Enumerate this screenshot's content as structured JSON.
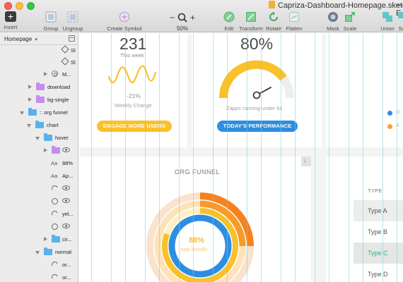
{
  "window": {
    "title": "Capriza-Dashboard-Homepage.sketch",
    "title_trailing": "— E"
  },
  "toolbar": {
    "insert_label": "Insert",
    "group_label": "Group",
    "ungroup_label": "Ungroup",
    "create_symbol_label": "Create Symbol",
    "zoom_minus": "−",
    "zoom_plus": "+",
    "zoom_value": "50%",
    "edit_label": "Edit",
    "transform_label": "Transform",
    "rotate_label": "Rotate",
    "flatten_label": "Flatten",
    "mask_label": "Mask",
    "scale_label": "Scale",
    "union_label": "Union",
    "subtract_label": "Su"
  },
  "sidebar": {
    "page_name": "Homepage",
    "caret": "▾",
    "layers": [
      {
        "label": "Sl",
        "icon": "slice"
      },
      {
        "label": "Sl",
        "icon": "slice"
      },
      {
        "label": "M...",
        "icon": "symbol"
      },
      {
        "label": "download",
        "icon": "folder-purple"
      },
      {
        "label": "bg-single",
        "icon": "folder-purple"
      },
      {
        "label": ":: org funnel",
        "icon": "folder-blue"
      },
      {
        "label": "chart",
        "icon": "folder-blue"
      },
      {
        "label": "hover",
        "icon": "folder-blue"
      },
      {
        "label": "",
        "icon": "folder-purple"
      },
      {
        "label": "88%",
        "icon": "text"
      },
      {
        "label": "Ap...",
        "icon": "text"
      },
      {
        "label": "",
        "icon": "arc"
      },
      {
        "label": "",
        "icon": "ring"
      },
      {
        "label": "yel...",
        "icon": "arc"
      },
      {
        "label": "",
        "icon": "ring"
      },
      {
        "label": "cir...",
        "icon": "folder-blue"
      },
      {
        "label": "normal",
        "icon": "folder-blue"
      },
      {
        "label": "or...",
        "icon": "arc"
      },
      {
        "label": "or...",
        "icon": "arc"
      }
    ],
    "text_glyph": "Aa"
  },
  "canvas": {
    "stat1": {
      "value": "231",
      "caption": "This week",
      "change": "-21%",
      "change_label": "Weekly Change",
      "button": "ENGAGE MORE USERS"
    },
    "stat2": {
      "value": "80%",
      "caption": "Zapps running under 6s",
      "button": "TODAY'S PERFORMANCE",
      "gauge_fraction": 0.8
    },
    "funnel": {
      "title": "ORG FUNNEL",
      "center_value": "88%",
      "center_label": "App installs"
    },
    "legend": [
      {
        "label": "O",
        "color": "#2d8ee0"
      },
      {
        "label": "A",
        "color": "#f5a623"
      }
    ],
    "type_table": {
      "header": "TYPE",
      "rows": [
        "Type A",
        "Type B",
        "Type C",
        "Type D"
      ],
      "selected": "Type C"
    },
    "download_glyph": "↓"
  },
  "colors": {
    "accent_yellow": "#f9c12a",
    "accent_blue": "#2d8ee0",
    "accent_orange": "#f58220",
    "grid_cyan": "#6ed7dc",
    "type_selected": "#2db57c"
  }
}
